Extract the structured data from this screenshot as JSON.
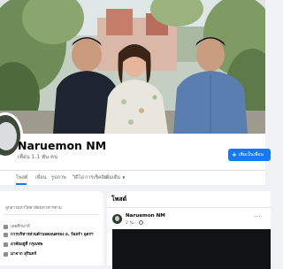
{
  "profile": {
    "name": "Naruemon NM",
    "friends_count": "เพื่อน 1.1 พัน คน",
    "add_friend_label": "เพิ่มเป็นเพื่อน"
  },
  "tabs": [
    {
      "label": "โพสต์"
    },
    {
      "label": "เพื่อน"
    },
    {
      "label": "รูปภาพ"
    },
    {
      "label": "วิดีโอ"
    },
    {
      "label": "การเช็คอิน"
    },
    {
      "label": "เพิ่มเติม"
    }
  ],
  "intro": {
    "line1": "ลูกสาวมหาวิทยาลัยมหาสารคาม",
    "line2": "เคยศึกษาที่",
    "line3": "การบริหารส่วนตำบลดอนตรอง อ. ร้อยรำ อุดรฯ",
    "line4": "อาศัยอยู่ที่ กรุงเทพ",
    "line5": "มาจาก สุรินทร์"
  },
  "posts": {
    "title": "โพสต์",
    "author": "Naruemon NM",
    "time": "2 วัน · "
  },
  "colors": {
    "accent": "#1877f2",
    "page_bg": "#f0f2f5"
  }
}
